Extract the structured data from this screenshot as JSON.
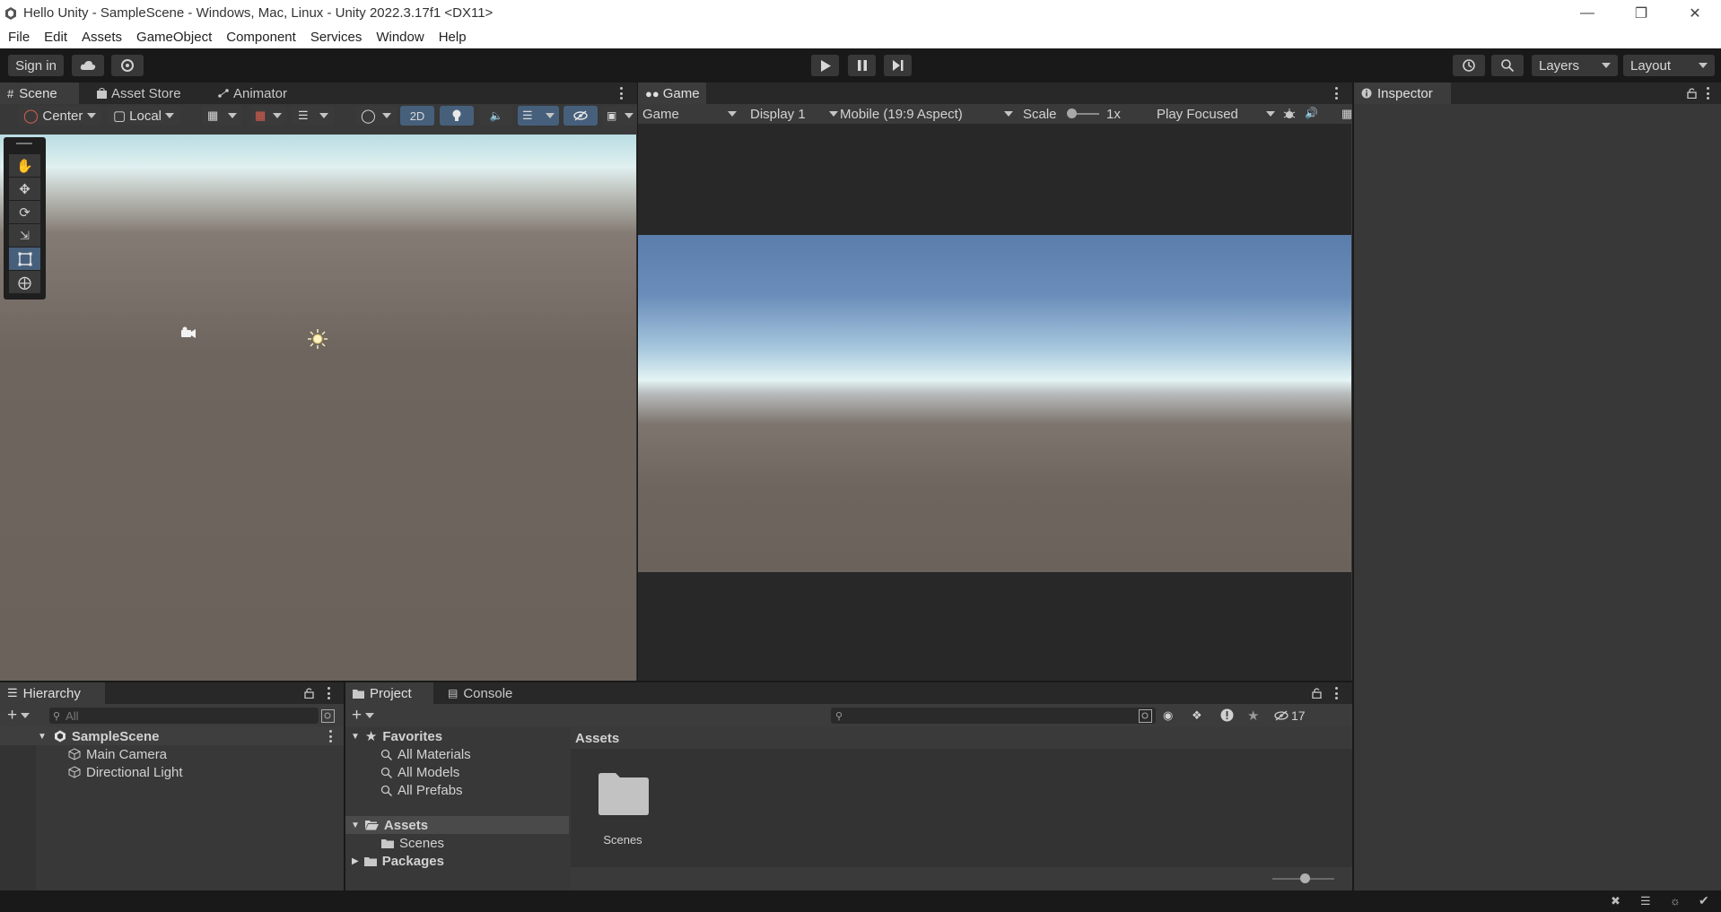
{
  "window": {
    "title": "Hello Unity - SampleScene - Windows, Mac, Linux - Unity 2022.3.17f1 <DX11>"
  },
  "menu": [
    "File",
    "Edit",
    "Assets",
    "GameObject",
    "Component",
    "Services",
    "Window",
    "Help"
  ],
  "toolbar": {
    "sign_in": "Sign in",
    "layers": "Layers",
    "layout": "Layout"
  },
  "scene_panel": {
    "tabs": [
      "Scene",
      "Asset Store",
      "Animator"
    ],
    "pivot": "Center",
    "space": "Local",
    "mode_2d": "2D"
  },
  "game_panel": {
    "tab": "Game",
    "view": "Game",
    "display": "Display 1",
    "aspect": "Mobile (19:9 Aspect)",
    "scale_label": "Scale",
    "scale_value": "1x",
    "play_mode": "Play Focused"
  },
  "inspector": {
    "tab": "Inspector"
  },
  "hierarchy": {
    "tab": "Hierarchy",
    "search_placeholder": "All",
    "scene": "SampleScene",
    "items": [
      "Main Camera",
      "Directional Light"
    ]
  },
  "project": {
    "tabs": [
      "Project",
      "Console"
    ],
    "hidden_count": "17",
    "favorites": "Favorites",
    "favorite_items": [
      "All Materials",
      "All Models",
      "All Prefabs"
    ],
    "assets_label": "Assets",
    "assets_children": [
      "Scenes"
    ],
    "packages_label": "Packages",
    "breadcrumb": "Assets",
    "grid_items": [
      "Scenes"
    ]
  },
  "colors": {
    "accent_blue": "#46607c",
    "panel_bg": "#383838",
    "toolbar_bg": "#191919"
  }
}
